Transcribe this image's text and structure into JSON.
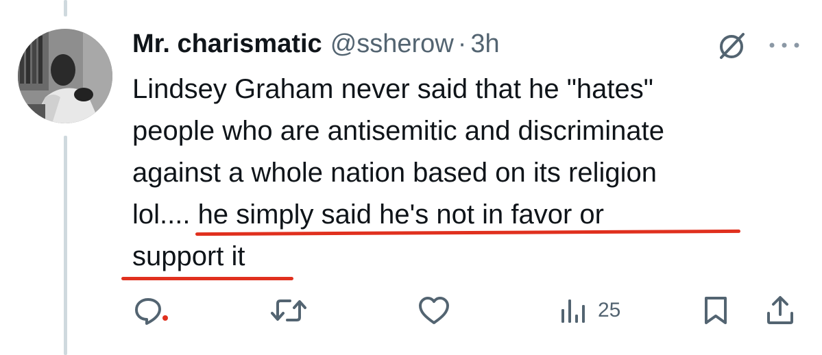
{
  "author": {
    "name": "Mr. charismatic",
    "handle": "@ssherow",
    "separator": "·",
    "time": "3h"
  },
  "tweet": {
    "lines": [
      "Lindsey Graham never said that he \"hates\"",
      "people who are antisemitic and discriminate",
      "against a whole nation based on its religion",
      "lol.... he simply said he's not in favor or",
      "support it"
    ]
  },
  "actions": {
    "reply_icon": "reply-icon",
    "retweet_icon": "retweet-icon",
    "like_icon": "heart-icon",
    "views_icon": "views-chart-icon",
    "views_count": "25",
    "bookmark_icon": "bookmark-icon",
    "share_icon": "share-icon"
  },
  "colors": {
    "text": "#0f1419",
    "secondary": "#536471",
    "underline": "#e0301e",
    "thread_line": "#cfd9de"
  }
}
